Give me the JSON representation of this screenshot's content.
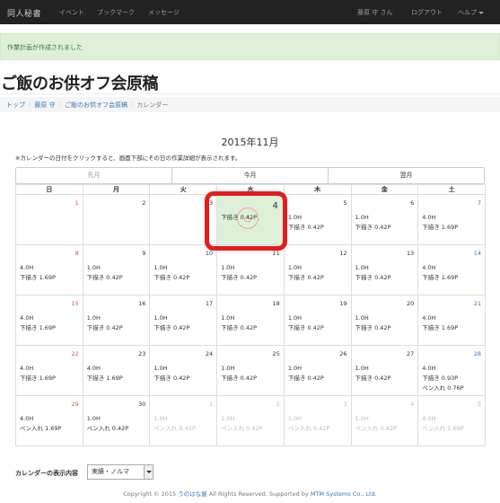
{
  "navbar": {
    "brand": "同人秘書",
    "links": [
      "イベント",
      "ブックマーク",
      "メッセージ"
    ],
    "user": "藤原 守 さん",
    "logout": "ログアウト",
    "help": "ヘルプ"
  },
  "alert": "作業計画が作成されました",
  "page_title": "ご飯のお供オフ会原稿",
  "breadcrumb": [
    "トップ",
    "藤原 守",
    "ご飯のお供オフ会原稿",
    "カレンダー"
  ],
  "calendar": {
    "title": "2015年11月",
    "note": "※カレンダーの日付をクリックすると、画面下部にその日の作業詳細が表示されます。",
    "nav": {
      "prev": "先月",
      "current": "今月",
      "next": "翌月"
    },
    "weekdays": [
      "日",
      "月",
      "火",
      "水",
      "木",
      "金",
      "土"
    ],
    "weeks": [
      [
        {
          "day": "1",
          "lines": []
        },
        {
          "day": "2",
          "lines": []
        },
        {
          "day": "3",
          "lines": []
        },
        {
          "day": "4",
          "lines": [
            "下描き 0.42P"
          ]
        },
        {
          "day": "5",
          "lines": [
            "1.0H",
            "下描き 0.42P"
          ]
        },
        {
          "day": "6",
          "lines": [
            "1.0H",
            "下描き 0.42P"
          ]
        },
        {
          "day": "7",
          "lines": [
            "4.0H",
            "下描き 1.69P"
          ]
        }
      ],
      [
        {
          "day": "8",
          "lines": [
            "4.0H",
            "下描き 1.69P"
          ]
        },
        {
          "day": "9",
          "lines": [
            "1.0H",
            "下描き 0.42P"
          ]
        },
        {
          "day": "10",
          "lines": [
            "1.0H",
            "下描き 0.42P"
          ]
        },
        {
          "day": "11",
          "lines": [
            "1.0H",
            "下描き 0.42P"
          ]
        },
        {
          "day": "12",
          "lines": [
            "1.0H",
            "下描き 0.42P"
          ]
        },
        {
          "day": "13",
          "lines": [
            "1.0H",
            "下描き 0.42P"
          ]
        },
        {
          "day": "14",
          "lines": [
            "4.0H",
            "下描き 1.69P"
          ]
        }
      ],
      [
        {
          "day": "15",
          "lines": [
            "4.0H",
            "下描き 1.69P"
          ]
        },
        {
          "day": "16",
          "lines": [
            "1.0H",
            "下描き 0.42P"
          ]
        },
        {
          "day": "17",
          "lines": [
            "1.0H",
            "下描き 0.42P"
          ]
        },
        {
          "day": "18",
          "lines": [
            "1.0H",
            "下描き 0.42P"
          ]
        },
        {
          "day": "19",
          "lines": [
            "1.0H",
            "下描き 0.42P"
          ]
        },
        {
          "day": "20",
          "lines": [
            "1.0H",
            "下描き 0.42P"
          ]
        },
        {
          "day": "21",
          "lines": [
            "4.0H",
            "下描き 1.69P"
          ]
        }
      ],
      [
        {
          "day": "22",
          "lines": [
            "4.0H",
            "下描き 1.69P"
          ]
        },
        {
          "day": "23",
          "lines": [
            "4.0H",
            "下描き 1.69P"
          ]
        },
        {
          "day": "24",
          "lines": [
            "1.0H",
            "下描き 0.42P"
          ]
        },
        {
          "day": "25",
          "lines": [
            "1.0H",
            "下描き 0.42P"
          ]
        },
        {
          "day": "26",
          "lines": [
            "1.0H",
            "下描き 0.42P"
          ]
        },
        {
          "day": "27",
          "lines": [
            "1.0H",
            "下描き 0.42P"
          ]
        },
        {
          "day": "28",
          "lines": [
            "4.0H",
            "下描き 0.93P",
            "ペン入れ 0.76P"
          ]
        }
      ],
      [
        {
          "day": "29",
          "lines": [
            "4.0H",
            "ペン入れ 1.69P"
          ]
        },
        {
          "day": "30",
          "lines": [
            "1.0H",
            "ペン入れ 0.42P"
          ]
        },
        {
          "day": "1",
          "lines": [
            "1.0H",
            "ペン入れ 0.42P"
          ]
        },
        {
          "day": "2",
          "lines": [
            "1.0H",
            "ペン入れ 0.42P"
          ]
        },
        {
          "day": "3",
          "lines": [
            "1.0H",
            "ペン入れ 0.42P"
          ]
        },
        {
          "day": "4",
          "lines": [
            "1.0H",
            "ペン入れ 0.42P"
          ]
        },
        {
          "day": "5",
          "lines": [
            "4.0H",
            "ペン入れ 1.69P"
          ]
        }
      ]
    ]
  },
  "display_setting": {
    "label": "カレンダーの表示内容",
    "value": "実績・ノルマ"
  },
  "footer": {
    "prefix": "Copyright © 2015 ",
    "org": "うのはな屋",
    "middle": " All Rights Reserved. Supported by ",
    "sponsor": "MTM Systems Co., Ltd."
  },
  "colors": {
    "today_bg": "#dff0d8",
    "highlight_ring": "#e41c1c",
    "sunday": "#d9534f",
    "saturday": "#337ab7"
  }
}
